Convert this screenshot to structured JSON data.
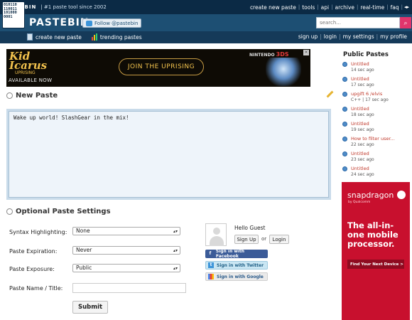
{
  "topbar": {
    "brand": "PASTEBIN",
    "tagline": "#1 paste tool since 2002",
    "links": [
      "create new paste",
      "tools",
      "api",
      "archive",
      "real-time",
      "faq"
    ]
  },
  "header": {
    "logo_binary": [
      "010110",
      "110011",
      "101000",
      "0001"
    ],
    "logo_text": "PASTEBIN",
    "follow_label": "Follow @pastebin",
    "search_placeholder": "search..."
  },
  "nav": {
    "create_label": "create new paste",
    "trending_label": "trending pastes",
    "right_links": [
      "sign up",
      "login",
      "my settings",
      "my profile"
    ]
  },
  "banner": {
    "logo_line1": "Kid",
    "logo_line2": "Icarus",
    "logo_line3": "UPRISING",
    "available": "AVAILABLE NOW",
    "button": "JOIN THE UPRISING",
    "console_prefix": "NINTENDO",
    "console_brand": "3DS",
    "close": "×"
  },
  "new_paste": {
    "title": "New Paste",
    "content": "Wake up world! SlashGear in the mix!"
  },
  "settings": {
    "title": "Optional Paste Settings",
    "syntax_label": "Syntax Highlighting:",
    "syntax_value": "None",
    "expiration_label": "Paste Expiration:",
    "expiration_value": "Never",
    "exposure_label": "Paste Exposure:",
    "exposure_value": "Public",
    "name_label": "Paste Name / Title:",
    "submit": "Submit"
  },
  "guest": {
    "hello": "Hello Guest",
    "signup": "Sign Up",
    "or": "or",
    "login": "Login",
    "facebook": "Sign in with Facebook",
    "twitter": "Sign in with Twitter",
    "google": "Sign in with Google"
  },
  "public_pastes": {
    "title": "Public Pastes",
    "items": [
      {
        "title": "Untitled",
        "meta": "14 sec ago"
      },
      {
        "title": "Untitled",
        "meta": "17 sec ago"
      },
      {
        "title": "upgift 6 /elvis",
        "meta": "C++ | 17 sec ago"
      },
      {
        "title": "Untitled",
        "meta": "18 sec ago"
      },
      {
        "title": "Untitled",
        "meta": "19 sec ago"
      },
      {
        "title": "How to filter user...",
        "meta": "22 sec ago"
      },
      {
        "title": "Untitled",
        "meta": "23 sec ago"
      },
      {
        "title": "Untitled",
        "meta": "24 sec ago"
      }
    ]
  },
  "side_ad": {
    "brand": "snapdragon",
    "by": "by Qualcomm",
    "headline": "The all-in-one mobile processor.",
    "button": "Find Your Next Device  >"
  },
  "colors": {
    "topbar": "#0b2a45",
    "header": "#1d4f73",
    "link_red": "#c0392b",
    "ad_red": "#c8102e"
  }
}
